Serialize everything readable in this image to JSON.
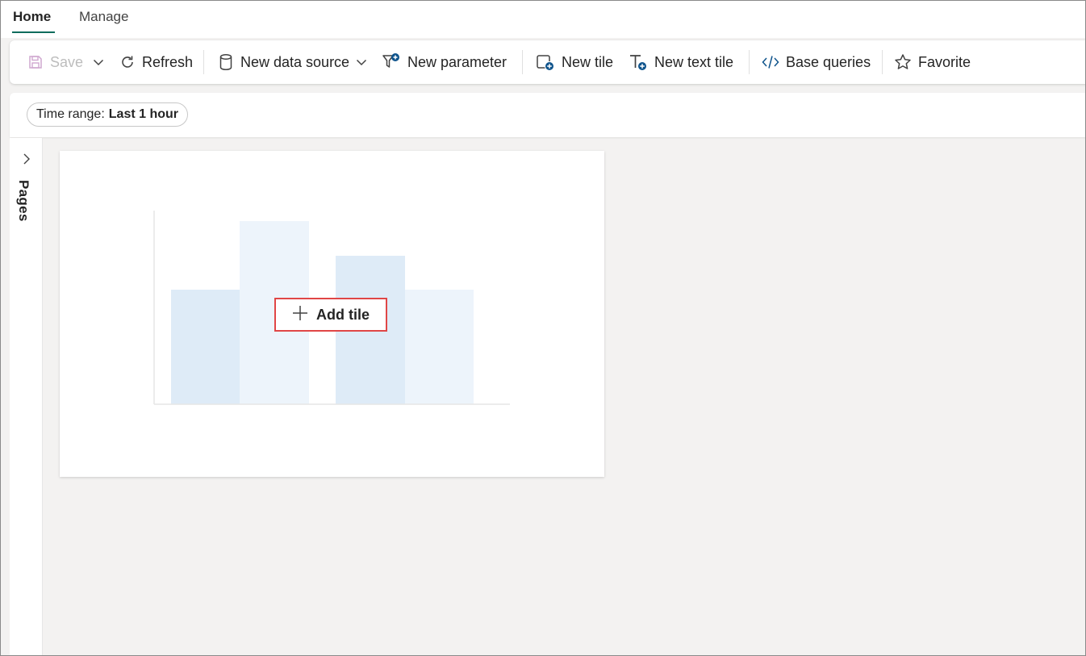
{
  "tabs": {
    "home": "Home",
    "manage": "Manage"
  },
  "toolbar": {
    "save": "Save",
    "refresh": "Refresh",
    "new_data_source": "New data source",
    "new_parameter": "New parameter",
    "new_tile": "New tile",
    "new_text_tile": "New text tile",
    "base_queries": "Base queries",
    "favorite": "Favorite"
  },
  "filters": {
    "time_range_label": "Time range:",
    "time_range_value": "Last 1 hour"
  },
  "pages_panel": {
    "label": "Pages"
  },
  "tile": {
    "add_tile_label": "Add tile"
  },
  "colors": {
    "accent_tab": "#0f6c5c",
    "highlight_border": "#e04646",
    "icon_blue": "#0f548c",
    "bar_dark": "#deebf7",
    "bar_light": "#edf4fb"
  }
}
